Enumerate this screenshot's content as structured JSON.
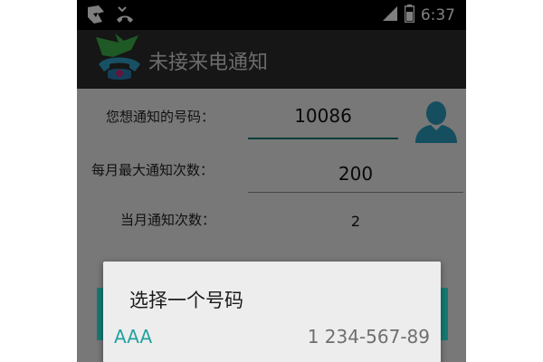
{
  "status_bar": {
    "time": "6:37",
    "icons": [
      "gallery-notification-icon",
      "missed-call-icon",
      "signal-icon",
      "battery-icon"
    ]
  },
  "action_bar": {
    "title": "未接来电通知",
    "icon": "app-logo-icon"
  },
  "form": {
    "phone_label": "您想通知的号码：",
    "phone_value": "10086",
    "max_label": "每月最大通知次数：",
    "max_value": "200",
    "month_label": "当月通知次数：",
    "month_value": "2",
    "contact_icon": "contact-person-icon"
  },
  "dialog": {
    "title": "选择一个号码",
    "items": [
      {
        "name": "AAA",
        "number": "1 234-567-89"
      }
    ]
  },
  "colors": {
    "accent": "#21a2a0",
    "accent_dark": "#167b73",
    "action_bar": "#2c2c2c",
    "status_bar": "#000000"
  }
}
